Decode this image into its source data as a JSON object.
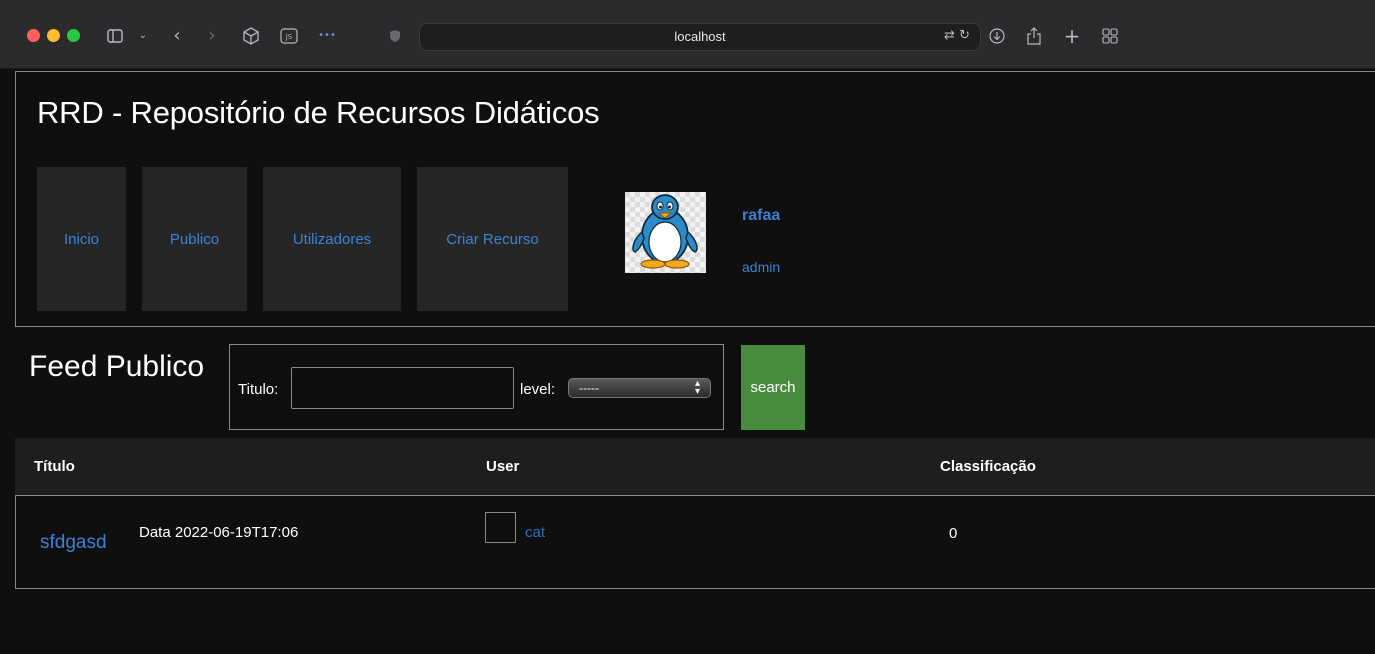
{
  "browser": {
    "url": "localhost",
    "icons": [
      "sidebar-icon",
      "chevron-down-icon",
      "back-icon",
      "forward-icon",
      "extension-cube-icon",
      "js-icon",
      "more-icon",
      "shield-icon",
      "translate-icon",
      "reload-icon",
      "download-icon",
      "share-icon",
      "new-tab-icon",
      "tab-overview-icon"
    ]
  },
  "site": {
    "title": "RRD - Repositório de Recursos Didáticos"
  },
  "nav": {
    "items": [
      {
        "label": "Inicio"
      },
      {
        "label": "Publico"
      },
      {
        "label": "Utilizadores"
      },
      {
        "label": "Criar Recurso"
      }
    ]
  },
  "user": {
    "name": "rafaa",
    "role": "admin"
  },
  "feed": {
    "title": "Feed Publico",
    "filter": {
      "titulo_label": "Titulo:",
      "titulo_value": "",
      "level_label": "level:",
      "level_selected": "-----",
      "search_label": "search"
    }
  },
  "table": {
    "headers": [
      "Título",
      "User",
      "Classificação"
    ],
    "rows": [
      {
        "title": "sfdgasd",
        "date": "Data 2022-06-19T17:06",
        "user": "cat",
        "classificacao": "0"
      }
    ]
  },
  "colors": {
    "link": "#3b82d6",
    "search_button": "#4a8c3f",
    "background": "#0f0f0f"
  }
}
